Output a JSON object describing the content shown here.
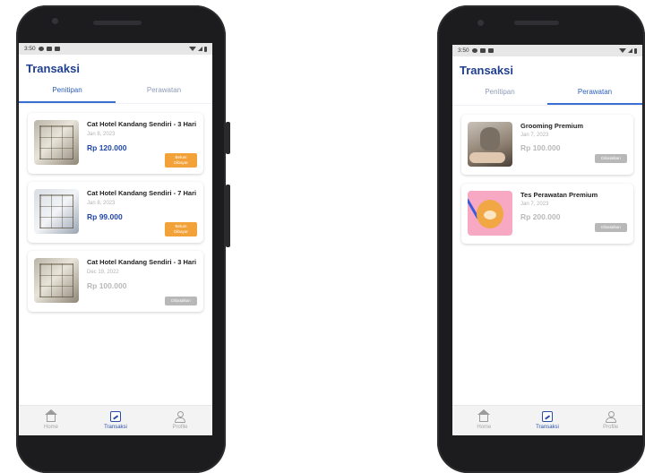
{
  "colors": {
    "title": "#1f3f8f",
    "tab_active": "#2b5fbd",
    "price": "#1f47a8",
    "badge_unpaid": "#f3a23a",
    "badge_cancelled": "#b8b8b8"
  },
  "left": {
    "status": {
      "time": "3:50"
    },
    "title": "Transaksi",
    "tabs": [
      {
        "label": "Penitipan",
        "active": true
      },
      {
        "label": "Perawatan",
        "active": false
      }
    ],
    "items": [
      {
        "name": "Cat Hotel Kandang Sendiri - 3 Hari",
        "date": "Jan 8, 2023",
        "price": "Rp 120.000",
        "badge": "Belum Dibayar",
        "status": "unpaid"
      },
      {
        "name": "Cat Hotel Kandang Sendiri - 7 Hari",
        "date": "Jan 8, 2023",
        "price": "Rp 99.000",
        "badge": "Belum Dibayar",
        "status": "unpaid"
      },
      {
        "name": "Cat Hotel Kandang Sendiri - 3 Hari",
        "date": "Dec 19, 2022",
        "price": "Rp 100.000",
        "badge": "Dibatalkan",
        "status": "cancelled"
      }
    ],
    "nav": [
      {
        "label": "Home",
        "icon": "home-icon"
      },
      {
        "label": "Transaksi",
        "icon": "chart-icon",
        "active": true
      },
      {
        "label": "Profile",
        "icon": "user-icon"
      }
    ]
  },
  "right": {
    "status": {
      "time": "3:50"
    },
    "title": "Transaksi",
    "tabs": [
      {
        "label": "Penitipan",
        "active": false
      },
      {
        "label": "Perawatan",
        "active": true
      }
    ],
    "items": [
      {
        "name": "Grooming Premium",
        "date": "Jan 7, 2023",
        "price": "Rp 100.000",
        "badge": "Dibatalkan",
        "status": "cancelled"
      },
      {
        "name": "Tes Perawatan Premium",
        "date": "Jan 7, 2023",
        "price": "Rp 200.000",
        "badge": "Dibatalkan",
        "status": "cancelled"
      }
    ],
    "nav": [
      {
        "label": "Home",
        "icon": "home-icon"
      },
      {
        "label": "Transaksi",
        "icon": "chart-icon",
        "active": true
      },
      {
        "label": "Profile",
        "icon": "user-icon"
      }
    ]
  }
}
